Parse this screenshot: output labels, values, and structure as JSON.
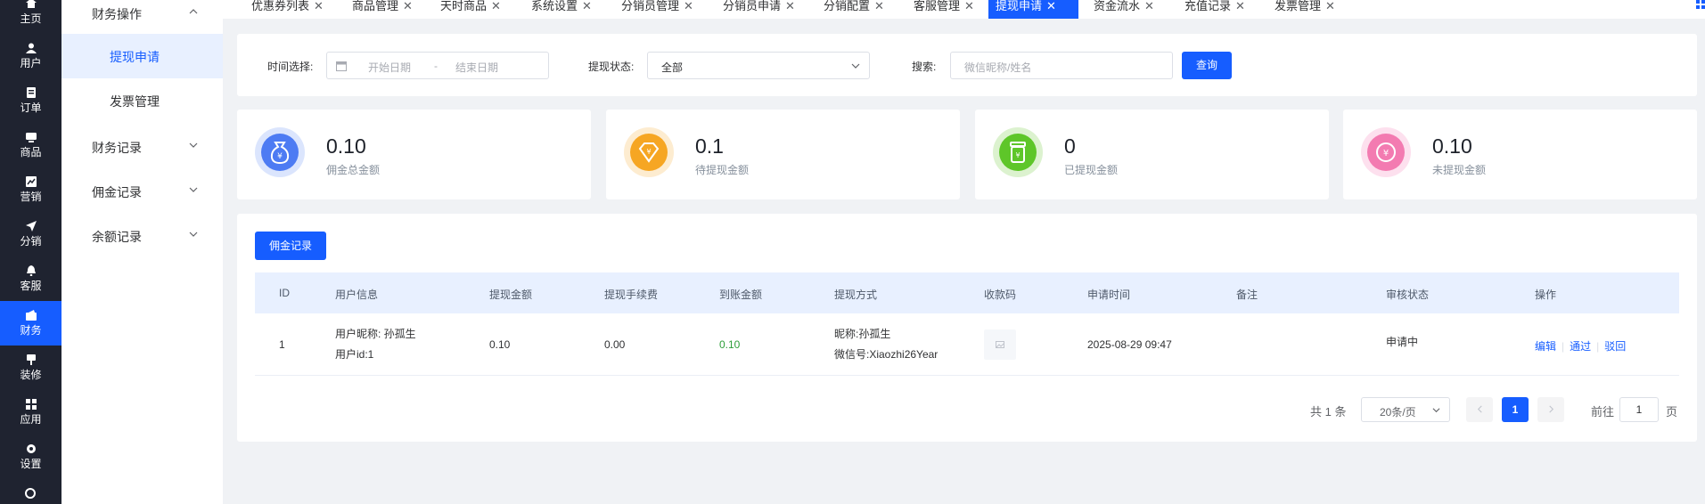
{
  "nav": {
    "items": [
      {
        "label": "主页",
        "icon": "home-icon"
      },
      {
        "label": "用户",
        "icon": "user-icon"
      },
      {
        "label": "订单",
        "icon": "order-icon"
      },
      {
        "label": "商品",
        "icon": "goods-icon"
      },
      {
        "label": "营销",
        "icon": "marketing-icon"
      },
      {
        "label": "分销",
        "icon": "send-icon"
      },
      {
        "label": "客服",
        "icon": "bell-icon"
      },
      {
        "label": "财务",
        "icon": "finance-icon"
      },
      {
        "label": "装修",
        "icon": "decorate-icon"
      },
      {
        "label": "应用",
        "icon": "apps-icon"
      },
      {
        "label": "设置",
        "icon": "gear-icon"
      }
    ]
  },
  "submenu": {
    "group1": "财务操作",
    "item_withdraw": "提现申请",
    "item_invoice": "发票管理",
    "group2": "财务记录",
    "group3": "佣金记录",
    "group4": "余额记录"
  },
  "tabs": [
    {
      "label": "优惠券列表"
    },
    {
      "label": "商品管理"
    },
    {
      "label": "天时商品"
    },
    {
      "label": "系统设置"
    },
    {
      "label": "分销员管理"
    },
    {
      "label": "分销员申请"
    },
    {
      "label": "分销配置"
    },
    {
      "label": "客服管理"
    },
    {
      "label": "提现申请"
    },
    {
      "label": "资金流水"
    },
    {
      "label": "充值记录"
    },
    {
      "label": "发票管理"
    }
  ],
  "filter": {
    "time_label": "时间选择:",
    "start_placeholder": "开始日期",
    "date_sep": "-",
    "end_placeholder": "结束日期",
    "status_label": "提现状态:",
    "status_value": "全部",
    "search_label": "搜索:",
    "search_placeholder": "微信昵称/姓名",
    "query_button": "查询"
  },
  "stats": [
    {
      "value": "0.10",
      "label": "佣金总金额",
      "color": "#4d7bf3",
      "ring": "#dbe5fd"
    },
    {
      "value": "0.1",
      "label": "待提现金额",
      "color": "#f6a623",
      "ring": "#fdecd0"
    },
    {
      "value": "0",
      "label": "已提现金额",
      "color": "#5ec629",
      "ring": "#dcf2cf"
    },
    {
      "value": "0.10",
      "label": "未提现金额",
      "color": "#f37bb1",
      "ring": "#fde0ee"
    }
  ],
  "table": {
    "record_button": "佣金记录",
    "columns": [
      "ID",
      "用户信息",
      "提现金额",
      "提现手续费",
      "到账金额",
      "提现方式",
      "收款码",
      "申请时间",
      "备注",
      "审核状态",
      "操作"
    ],
    "rows": [
      {
        "id": "1",
        "user_nick": "用户昵称: 孙孤生",
        "user_id": "用户id:1",
        "amount": "0.10",
        "fee": "0.00",
        "received": "0.10",
        "method_nick": "昵称:孙孤生",
        "method_wechat": "微信号:Xiaozhi26Year",
        "apply_time": "2025-08-29 09:47",
        "remark": "",
        "status": "申请中",
        "action_edit": "编辑",
        "action_pass": "通过",
        "action_reject": "驳回"
      }
    ]
  },
  "pagination": {
    "total": "共 1 条",
    "page_size": "20条/页",
    "current": "1",
    "goto_label": "前往",
    "goto_value": "1",
    "page_suffix": "页"
  },
  "colors": {
    "primary": "#165dff",
    "nav_bg": "#1f2330",
    "received_green": "#2e9e3a"
  }
}
